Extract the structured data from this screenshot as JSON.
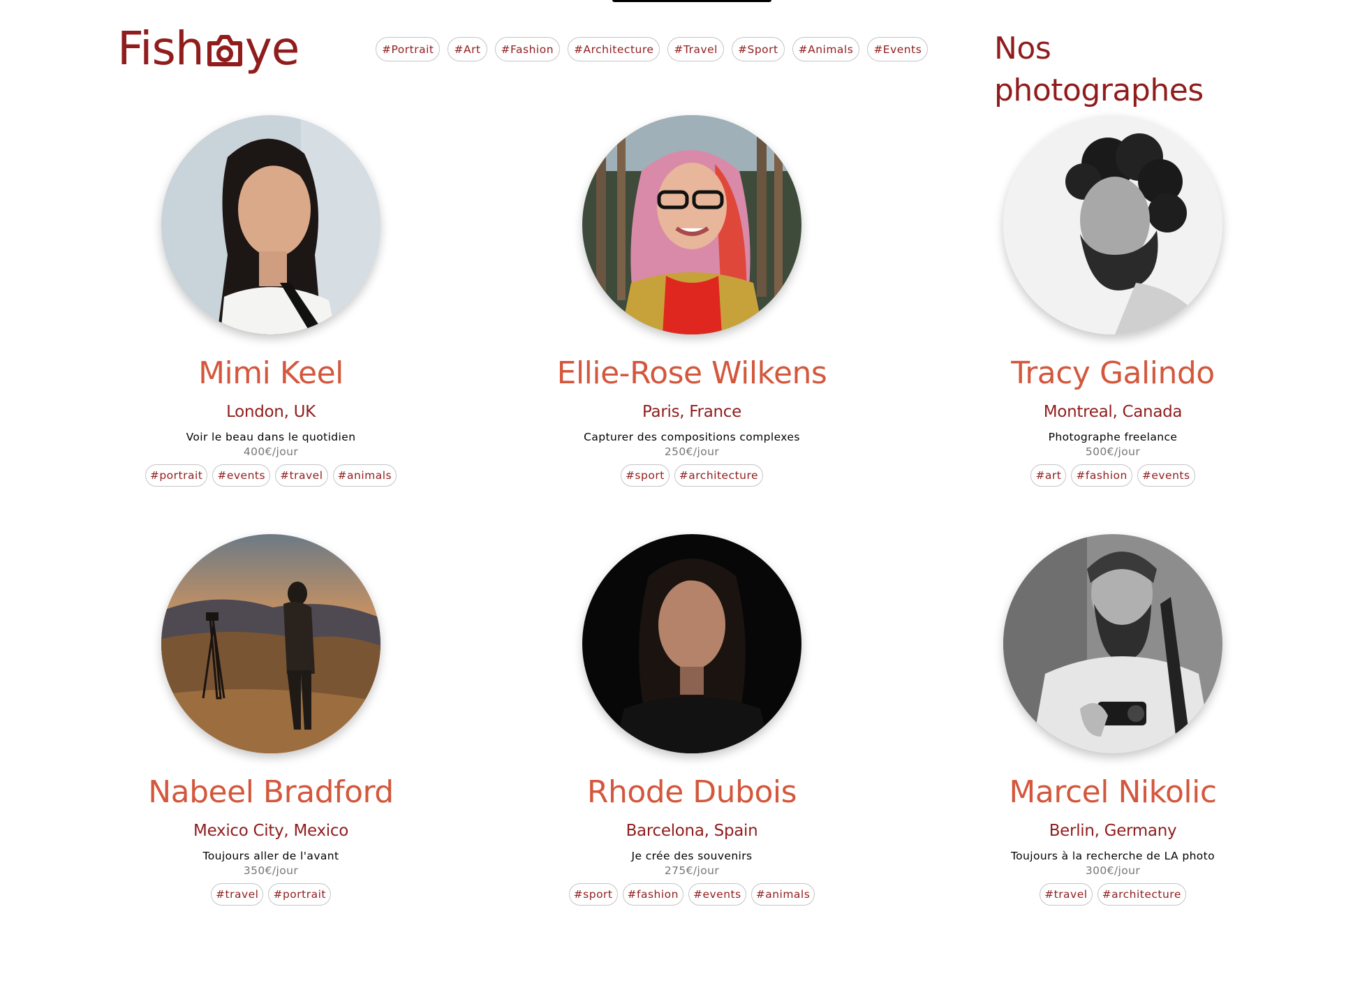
{
  "header": {
    "logo_text_left": "Fish",
    "logo_text_right": "ye",
    "title": "Nos photographes",
    "tags": [
      "#Portrait",
      "#Art",
      "#Fashion",
      "#Architecture",
      "#Travel",
      "#Sport",
      "#Animals",
      "#Events"
    ]
  },
  "colors": {
    "brand": "#901C1C",
    "accent": "#D3573C",
    "muted": "#757575"
  },
  "photographers": [
    {
      "name": "Mimi Keel",
      "location": "London, UK",
      "tagline": "Voir le beau dans le quotidien",
      "price": "400€/jour",
      "tags": [
        "#portrait",
        "#events",
        "#travel",
        "#animals"
      ]
    },
    {
      "name": "Ellie-Rose Wilkens",
      "location": "Paris, France",
      "tagline": "Capturer des compositions complexes",
      "price": "250€/jour",
      "tags": [
        "#sport",
        "#architecture"
      ]
    },
    {
      "name": "Tracy Galindo",
      "location": "Montreal, Canada",
      "tagline": "Photographe freelance",
      "price": "500€/jour",
      "tags": [
        "#art",
        "#fashion",
        "#events"
      ]
    },
    {
      "name": "Nabeel Bradford",
      "location": "Mexico City, Mexico",
      "tagline": "Toujours aller de l'avant",
      "price": "350€/jour",
      "tags": [
        "#travel",
        "#portrait"
      ]
    },
    {
      "name": "Rhode Dubois",
      "location": "Barcelona, Spain",
      "tagline": "Je crée des souvenirs",
      "price": "275€/jour",
      "tags": [
        "#sport",
        "#fashion",
        "#events",
        "#animals"
      ]
    },
    {
      "name": "Marcel Nikolic",
      "location": "Berlin, Germany",
      "tagline": "Toujours à la recherche de LA photo",
      "price": "300€/jour",
      "tags": [
        "#travel",
        "#architecture"
      ]
    }
  ]
}
